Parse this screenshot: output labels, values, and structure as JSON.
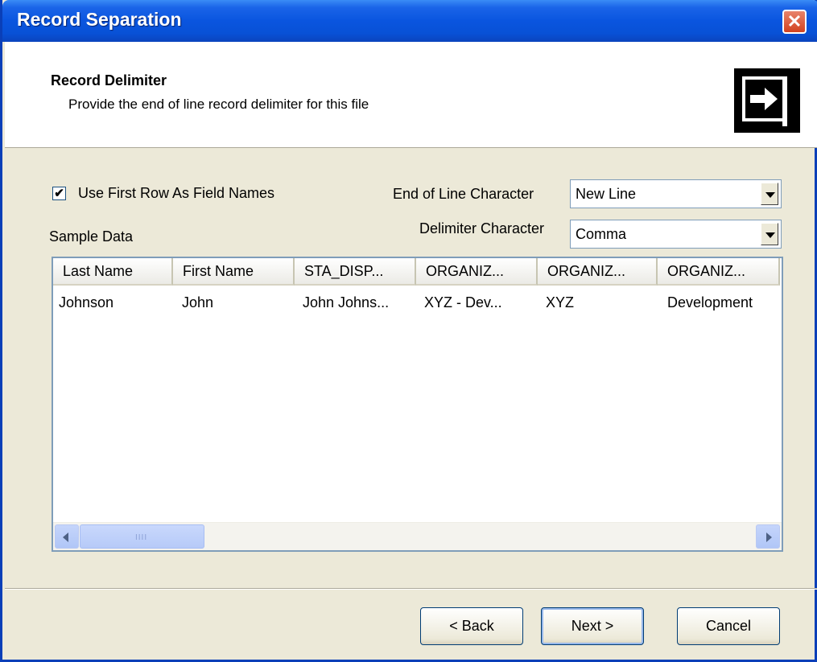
{
  "window": {
    "title": "Record Separation",
    "close_glyph": "✕"
  },
  "header": {
    "title": "Record Delimiter",
    "subtitle": "Provide the end of line record delimiter for this file",
    "icon": "wizard-arrow-icon"
  },
  "options": {
    "use_first_row_label": "Use First Row As Field Names",
    "use_first_row_checked": true,
    "check_glyph": "✔",
    "sample_data_label": "Sample Data",
    "end_of_line_label": "End of Line Character",
    "end_of_line_value": "New Line",
    "delimiter_label": "Delimiter Character",
    "delimiter_value": "Comma"
  },
  "grid": {
    "columns": [
      "Last Name",
      "First Name",
      "STA_DISP...",
      "ORGANIZ...",
      "ORGANIZ...",
      "ORGANIZ..."
    ],
    "rows": [
      [
        "Johnson",
        "John",
        "John Johns...",
        "XYZ - Dev...",
        "XYZ",
        "Development"
      ]
    ],
    "scroll_grip": "IIII"
  },
  "buttons": {
    "back": "< Back",
    "next": "Next >",
    "cancel": "Cancel"
  },
  "colors": {
    "titlebar": "#0a55df",
    "dialog_face": "#ece9d8",
    "close_button": "#d2421f"
  }
}
